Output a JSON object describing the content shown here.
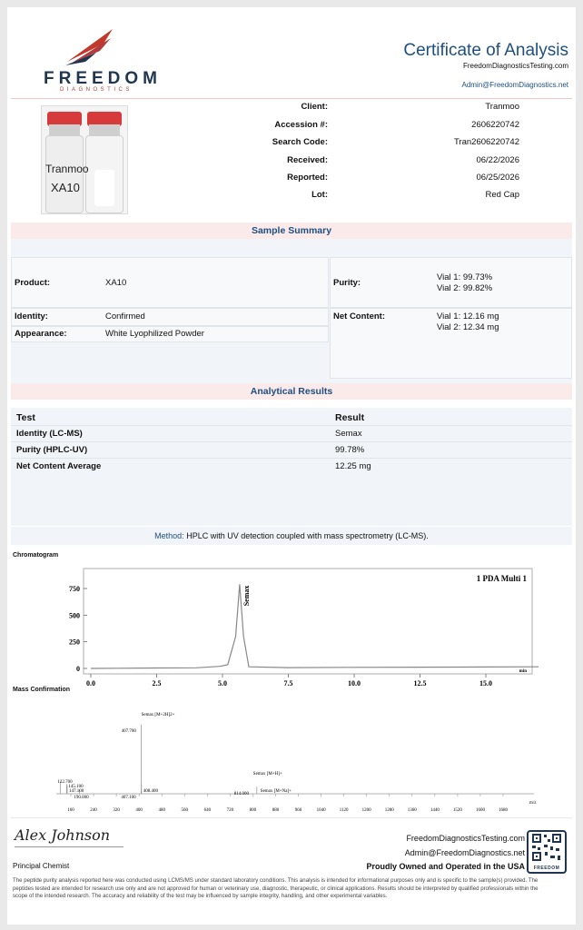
{
  "header": {
    "brand": "FREEDOM",
    "brand_sub": "DIAGNOSTICS",
    "title": "Certificate of Analysis",
    "website": "FreedomDiagnosticsTesting.com",
    "email": "Admin@FreedomDiagnostics.net"
  },
  "vial_label": {
    "line1": "Tranmoo",
    "line2": "XA10"
  },
  "info": [
    {
      "label": "Client:",
      "value": "Tranmoo"
    },
    {
      "label": "Accession #:",
      "value": "2606220742"
    },
    {
      "label": "Search Code:",
      "value": "Tran2606220742"
    },
    {
      "label": "Received:",
      "value": "06/22/2026"
    },
    {
      "label": "Reported:",
      "value": "06/25/2026"
    },
    {
      "label": "Lot:",
      "value": "Red Cap"
    }
  ],
  "summary": {
    "heading": "Sample Summary",
    "product_label": "Product:",
    "product": "XA10",
    "identity_label": "Identity:",
    "identity": "Confirmed",
    "appearance_label": "Appearance:",
    "appearance": "White Lyophilized Powder",
    "purity_label": "Purity:",
    "purity_v1": "Vial 1: 99.73%",
    "purity_v2": "Vial 2: 99.82%",
    "net_label": "Net Content:",
    "net_v1": "Vial 1: 12.16 mg",
    "net_v2": "Vial 2: 12.34 mg"
  },
  "results": {
    "heading": "Analytical Results",
    "col_test": "Test",
    "col_result": "Result",
    "rows": [
      {
        "test": "Identity (LC-MS)",
        "result": "Semax"
      },
      {
        "test": "Purity (HPLC-UV)",
        "result": "99.78%"
      },
      {
        "test": "Net Content Average",
        "result": "12.25 mg"
      }
    ]
  },
  "method": {
    "label": "Method:",
    "text": "HPLC with UV detection coupled with mass spectrometry (LC-MS)."
  },
  "chromatogram": {
    "heading": "Chromatogram",
    "legend": "1 PDA Multi 1",
    "unit": "min",
    "peak_label": "Semax",
    "yticks": [
      "0",
      "250",
      "500",
      "750"
    ],
    "xticks": [
      "0.0",
      "2.5",
      "5.0",
      "7.5",
      "10.0",
      "12.5",
      "15.0"
    ]
  },
  "mass": {
    "heading": "Mass Confirmation",
    "xlabel": "m/z",
    "xticks": [
      "160",
      "240",
      "320",
      "400",
      "480",
      "560",
      "640",
      "720",
      "800",
      "880",
      "960",
      "1040",
      "1120",
      "1200",
      "1280",
      "1360",
      "1440",
      "1520",
      "1600",
      "1680"
    ],
    "labels": {
      "m2h": "Semax [M+2H]2+",
      "mh": "Semax [M+H]+",
      "mna": "Semax [M+Na]+",
      "p407": "407.700",
      "p122": "122.700",
      "p145": "145.100",
      "p147": "147.100",
      "p190": "190.000",
      "p407b": "407.100",
      "p408": "408.400",
      "p814": "814.000"
    }
  },
  "chart_data": [
    {
      "type": "line",
      "title": "",
      "xlabel": "min",
      "ylabel": "",
      "xlim": [
        0,
        17
      ],
      "ylim": [
        -50,
        800
      ],
      "series": [
        {
          "name": "1 PDA Multi 1",
          "x": [
            0.0,
            1.0,
            2.5,
            4.0,
            4.9,
            5.2,
            5.5,
            5.65,
            5.8,
            6.0,
            7.5,
            10.0,
            12.5,
            15.0,
            17.0
          ],
          "y": [
            0,
            2,
            4,
            6,
            20,
            35,
            300,
            790,
            300,
            15,
            8,
            10,
            12,
            14,
            15
          ]
        }
      ],
      "annotations": [
        "Semax"
      ]
    },
    {
      "type": "bar",
      "title": "",
      "xlabel": "m/z",
      "xlim": [
        120,
        1720
      ],
      "series": [
        {
          "x": [
            122.7,
            145.1,
            147.1,
            190.0,
            407.1,
            407.7,
            408.4,
            814.0
          ],
          "y": [
            18,
            14,
            12,
            6,
            5,
            100,
            14,
            10
          ]
        }
      ],
      "annotations": [
        "Semax [M+2H]2+",
        "Semax [M+H]+",
        "Semax [M+Na]+"
      ]
    }
  ],
  "footer": {
    "signature": "Alex Johnson",
    "role": "Principal Chemist",
    "website": "FreedomDiagnosticsTesting.com",
    "email": "Admin@FreedomDiagnostics.net",
    "tagline": "Proudly Owned and Operated in the USA",
    "badge_text": "FREEDOM",
    "disclaimer": "The peptide purity analysis reported here was conducted using LCMS/MS under standard laboratory conditions. This analysis is intended for informational purposes only and is specific to the sample(s) provided. The peptides tested are intended for research use only and are not approved for human or veterinary use, diagnostic, therapeutic, or clinical applications. Results should be interpreted by qualified professionals within the scope of the intended research. The accuracy and reliability of the test may be influenced by sample integrity, handling, and other experimental variables."
  }
}
